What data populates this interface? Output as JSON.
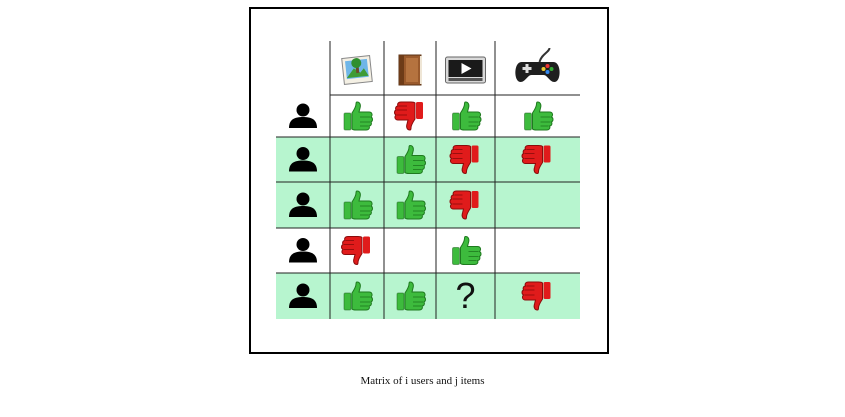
{
  "caption": "Matrix of i users and j items",
  "body_text": "",
  "items": [
    {
      "name": "photo-item-icon"
    },
    {
      "name": "book-item-icon"
    },
    {
      "name": "video-item-icon"
    },
    {
      "name": "gamepad-item-icon"
    }
  ],
  "rows": [
    {
      "highlight": false,
      "ratings": [
        "up",
        "down",
        "up",
        "up"
      ]
    },
    {
      "highlight": true,
      "ratings": [
        "",
        "up",
        "down",
        "down"
      ]
    },
    {
      "highlight": true,
      "ratings": [
        "up",
        "up",
        "down",
        ""
      ]
    },
    {
      "highlight": false,
      "ratings": [
        "down",
        "",
        "up",
        ""
      ]
    },
    {
      "highlight": true,
      "ratings": [
        "up",
        "up",
        "?",
        "down"
      ]
    }
  ],
  "unknown_label": "?",
  "colors": {
    "row_highlight": "#b7f5cf",
    "thumb_up": "#3dbb3d",
    "thumb_down": "#e01b1b",
    "user": "#000000",
    "grid": "#222222"
  }
}
